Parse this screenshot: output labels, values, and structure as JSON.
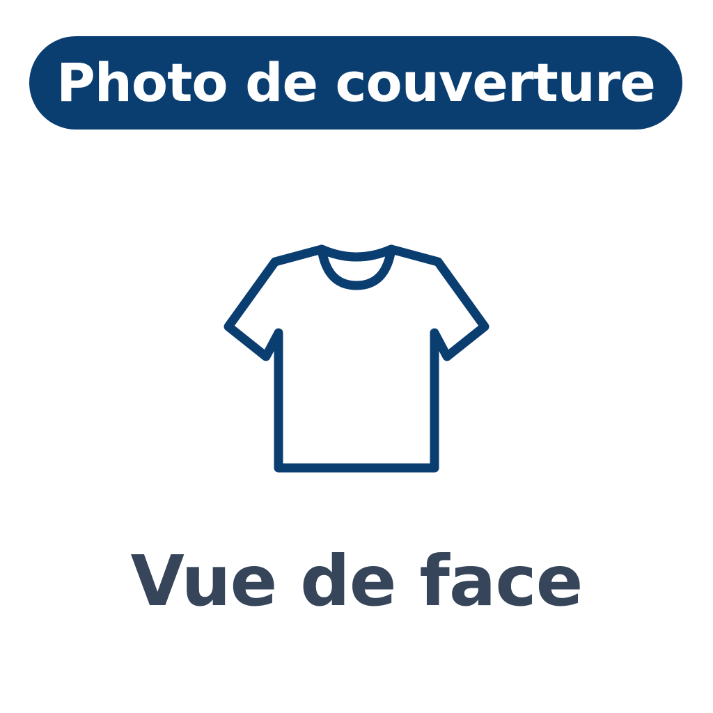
{
  "banner": {
    "title": "Photo de couverture",
    "background_color": "#0a3d70",
    "text_color": "#ffffff"
  },
  "illustration": {
    "icon": "tshirt-icon",
    "stroke_color": "#0a3d70"
  },
  "caption": {
    "text": "Vue de face",
    "color": "#364559"
  }
}
